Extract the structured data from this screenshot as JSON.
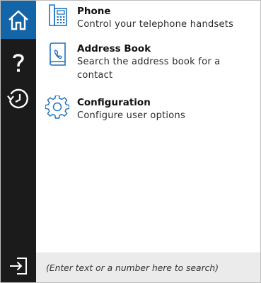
{
  "sidebar": {
    "items": [
      {
        "icon": "home-icon",
        "active": true
      },
      {
        "icon": "help-icon",
        "active": false
      },
      {
        "icon": "history-icon",
        "active": false
      }
    ],
    "bottom": {
      "icon": "sign-out-icon"
    }
  },
  "menu": {
    "items": [
      {
        "icon": "phone-icon",
        "title": "Phone",
        "description": "Control your telephone handsets"
      },
      {
        "icon": "address-book-icon",
        "title": "Address Book",
        "description": "Search the address book for a contact"
      },
      {
        "icon": "gear-icon",
        "title": "Configuration",
        "description": "Configure user options"
      }
    ]
  },
  "search": {
    "placeholder": "(Enter text or a number here to search)"
  },
  "colors": {
    "rail_background": "#1b1b1b",
    "active_rail_item": "#1464a8",
    "icon_accent": "#1e73be",
    "search_background": "#ebebeb"
  }
}
